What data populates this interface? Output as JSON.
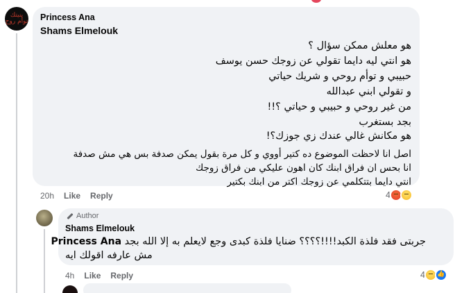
{
  "comment": {
    "author": "Princess Ana",
    "mention": "Shams Elmelouk",
    "avatar_text": "بنيتك\nتوأم روح",
    "lines_block1": [
      "هو معلش ممكن سؤال ؟",
      "هو انتي ليه دايما تقولي عن زوجك حسن يوسف",
      "حبيبي و توأم روحي و شريك حياتي",
      "و تقولي ابني عبدالله",
      "من غير روحي و حبيبي و حياتي ؟!!",
      "بجد بستغرب",
      "هو مكانش غالي عندك زي جوزك؟!"
    ],
    "lines_block2": [
      "اصل انا لاحظت الموضوع ده كتير أووي و كل مرة بقول يمكن صدفة بس هي مش صدفة",
      "انا بحس ان فراق ابنك كان اهون عليكي من فراق زوجك",
      "انتي دايما بتتكلمي عن زوجك اكتر من ابنك بكتير"
    ],
    "time": "20h",
    "like_label": "Like",
    "reply_label": "Reply",
    "reaction_count": "4",
    "reaction_icons": [
      "angry-emoji",
      "sad-emoji"
    ]
  },
  "reply": {
    "badge": "Author",
    "author": "Shams Elmelouk",
    "mention": "Princess Ana",
    "line1": "جربتى فقد فلذة الكبد!!!!؟؟؟؟ ضنايا فلذة كبدى وجع لايعلم به إلا الله بجد",
    "line2": "مش عارفه اقولك ايه",
    "time": "4h",
    "like_label": "Like",
    "reply_label": "Reply",
    "reaction_count": "4",
    "reaction_icons": [
      "sad-emoji",
      "like-emoji"
    ]
  },
  "colors": {
    "bubble": "#f0f2f5",
    "meta_text": "#65676b",
    "thread_line": "#ced0d4"
  }
}
